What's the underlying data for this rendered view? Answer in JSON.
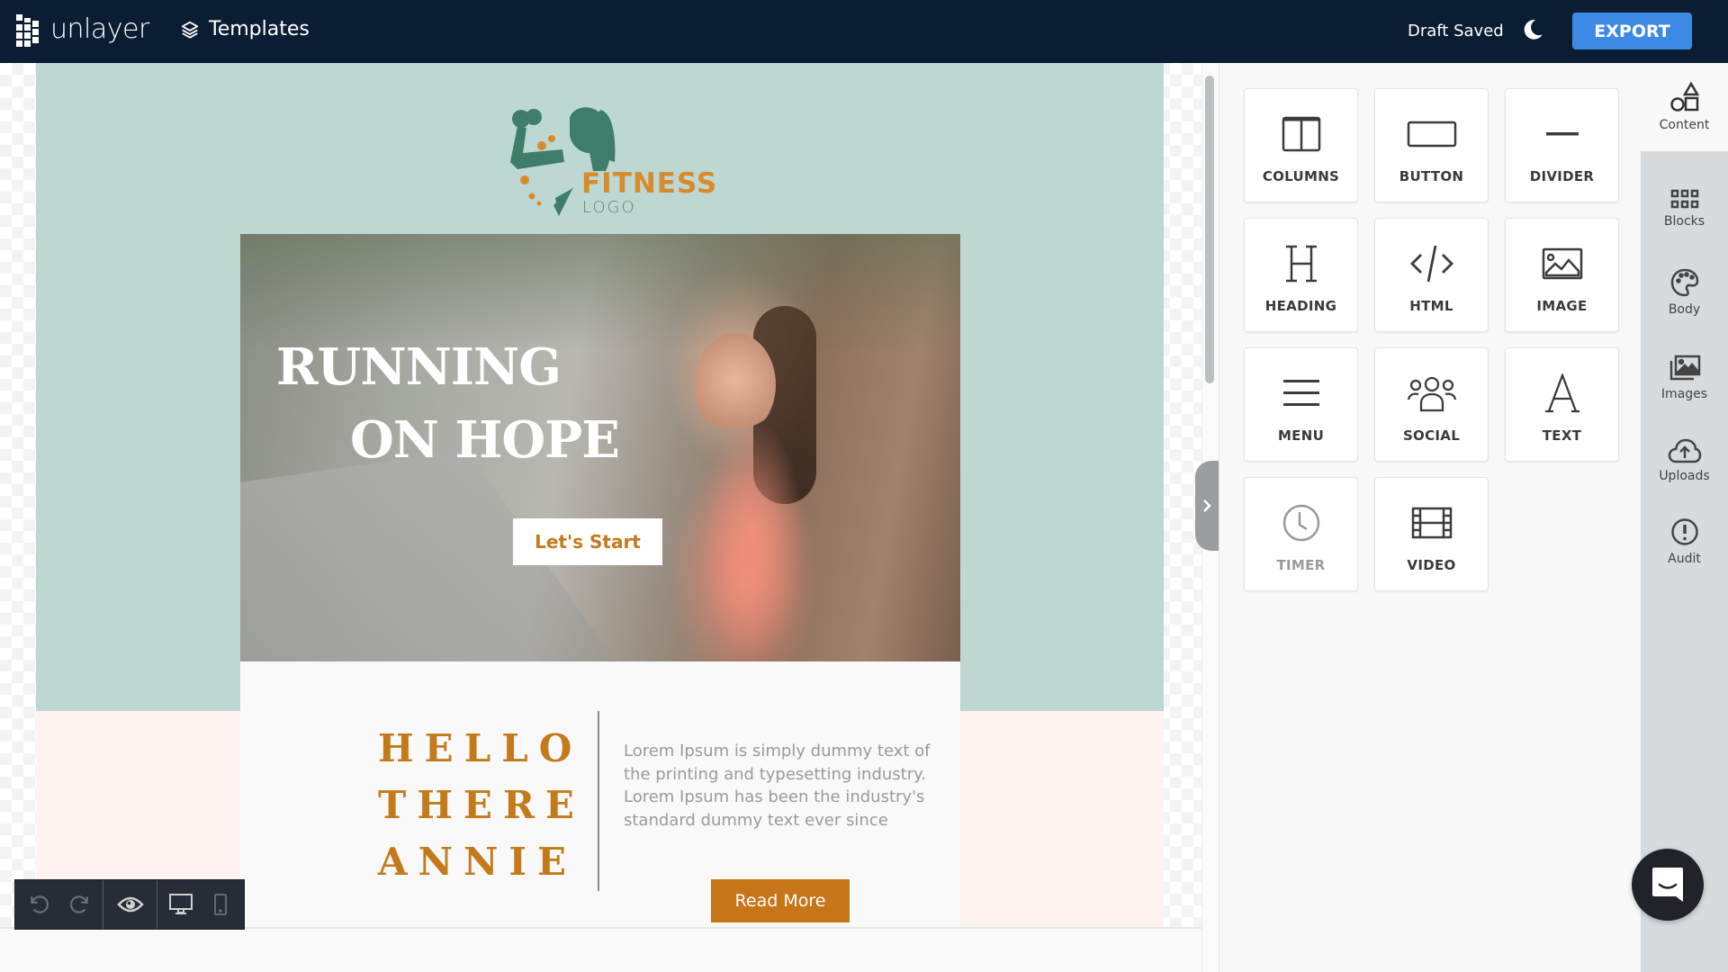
{
  "app": {
    "brand_name": "unlayer",
    "templates_label": "Templates",
    "status_text": "Draft Saved",
    "export_label": "EXPORT",
    "colors": {
      "topbar": "#0b1d33",
      "export_button": "#3d8ae5",
      "accent_orange": "#c47a1b",
      "email_teal": "#bdd8d3",
      "email_pink": "#fdf4f2"
    }
  },
  "email": {
    "logo": {
      "title": "FITNESS",
      "subtitle": "LOGO"
    },
    "hero": {
      "title_line1": "RUNNING",
      "title_line2": "ON HOPE",
      "cta_label": "Let's Start"
    },
    "intro": {
      "heading_lines": [
        "HELLO",
        "THERE",
        "ANNIE"
      ],
      "body": "Lorem Ipsum is simply dummy text of the printing and typesetting industry. Lorem Ipsum has been the industry's standard dummy text ever since",
      "cta_label": "Read More"
    }
  },
  "toolbar": {
    "items": [
      {
        "icon": "undo-icon"
      },
      {
        "icon": "redo-icon"
      },
      {
        "icon": "eye-icon"
      },
      {
        "icon": "desktop-icon"
      },
      {
        "icon": "mobile-icon"
      }
    ]
  },
  "content_blocks": [
    {
      "label": "COLUMNS",
      "icon": "columns-icon",
      "disabled": false
    },
    {
      "label": "BUTTON",
      "icon": "button-icon",
      "disabled": false
    },
    {
      "label": "DIVIDER",
      "icon": "divider-icon",
      "disabled": false
    },
    {
      "label": "HEADING",
      "icon": "heading-icon",
      "disabled": false
    },
    {
      "label": "HTML",
      "icon": "code-icon",
      "disabled": false
    },
    {
      "label": "IMAGE",
      "icon": "image-icon",
      "disabled": false
    },
    {
      "label": "MENU",
      "icon": "menu-icon",
      "disabled": false
    },
    {
      "label": "SOCIAL",
      "icon": "social-icon",
      "disabled": false
    },
    {
      "label": "TEXT",
      "icon": "text-icon",
      "disabled": false
    },
    {
      "label": "TIMER",
      "icon": "clock-icon",
      "disabled": true
    },
    {
      "label": "VIDEO",
      "icon": "video-icon",
      "disabled": false
    }
  ],
  "rail_tabs": [
    {
      "label": "Content",
      "icon": "shapes-icon",
      "active": true
    },
    {
      "label": "Blocks",
      "icon": "grid-icon",
      "active": false
    },
    {
      "label": "Body",
      "icon": "palette-icon",
      "active": false
    },
    {
      "label": "Images",
      "icon": "images-icon",
      "active": false
    },
    {
      "label": "Uploads",
      "icon": "cloud-upload-icon",
      "active": false
    },
    {
      "label": "Audit",
      "icon": "alert-icon",
      "active": false
    }
  ]
}
